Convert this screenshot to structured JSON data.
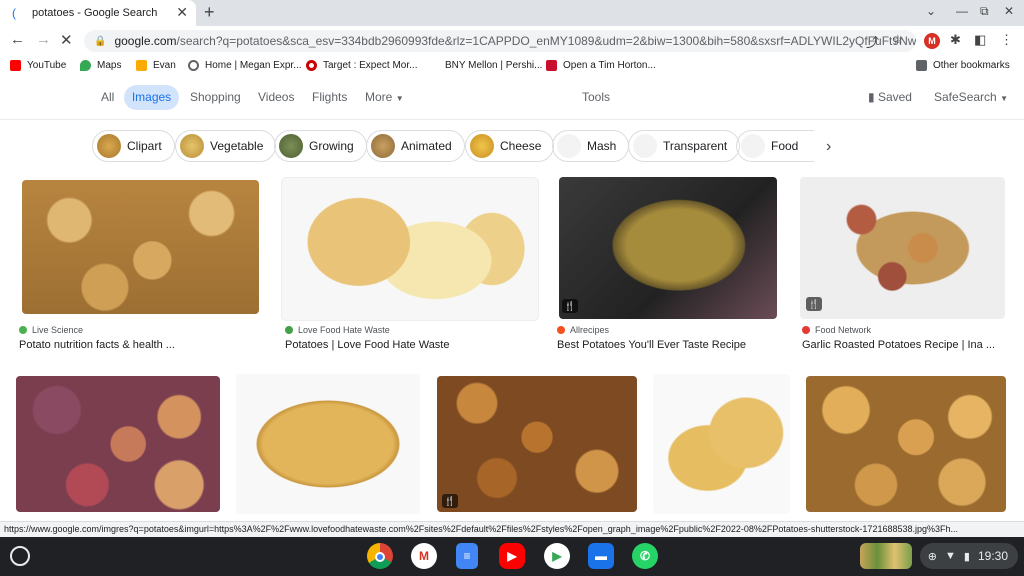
{
  "browser": {
    "tab_title": "potatoes - Google Search",
    "new_tab": "+",
    "url_host": "google.com",
    "url_path": "/search?q=potatoes&sca_esv=334bdb2960993fde&rlz=1CAPPDO_enMY1089&udm=2&biw=1300&bih=580&sxsrf=ADLYWIL2yQfFuFt9NwMl..."
  },
  "bookmarks": [
    {
      "label": "YouTube",
      "color": "#ff0000"
    },
    {
      "label": "Maps",
      "color": "#34a853"
    },
    {
      "label": "Evan",
      "color": "#f9ab00"
    },
    {
      "label": "Home | Megan Expr...",
      "color": "#5f6368"
    },
    {
      "label": "Target : Expect Mor...",
      "color": "#cc0000"
    },
    {
      "label": "BNY Mellon | Pershi...",
      "color": "#ffffff"
    },
    {
      "label": "Open a Tim Horton...",
      "color": "#c8102e"
    },
    {
      "label": "Other bookmarks",
      "color": "#5f6368"
    }
  ],
  "google_nav": {
    "all": "All",
    "images": "Images",
    "shopping": "Shopping",
    "videos": "Videos",
    "flights": "Flights",
    "more": "More",
    "tools": "Tools",
    "saved": "Saved",
    "safesearch": "SafeSearch"
  },
  "chips": [
    "Clipart",
    "Vegetable",
    "Growing",
    "Animated",
    "Cheese",
    "Mash",
    "Transparent",
    "Food"
  ],
  "results_row1": [
    {
      "source": "Live Science",
      "title": "Potato nutrition facts & health ...",
      "source_color": "#4caf50"
    },
    {
      "source": "Love Food Hate Waste",
      "title": "Potatoes | Love Food Hate Waste",
      "source_color": "#43a047"
    },
    {
      "source": "Allrecipes",
      "title": "Best Potatoes You'll Ever Taste Recipe",
      "source_color": "#f4511e"
    },
    {
      "source": "Food Network",
      "title": "Garlic Roasted Potatoes Recipe | Ina ...",
      "source_color": "#e53935"
    }
  ],
  "status_url": "https://www.google.com/imgres?q=potatoes&imgurl=https%3A%2F%2Fwww.lovefoodhatewaste.com%2Fsites%2Fdefault%2Ffiles%2Fstyles%2Fopen_graph_image%2Fpublic%2F2022-08%2FPotatoes-shutterstock-1721688538.jpg%3Fh...",
  "shelf": {
    "time": "19:30",
    "apps": [
      "chrome",
      "gmail",
      "docs",
      "youtube",
      "play-store",
      "files",
      "whatsapp"
    ]
  }
}
